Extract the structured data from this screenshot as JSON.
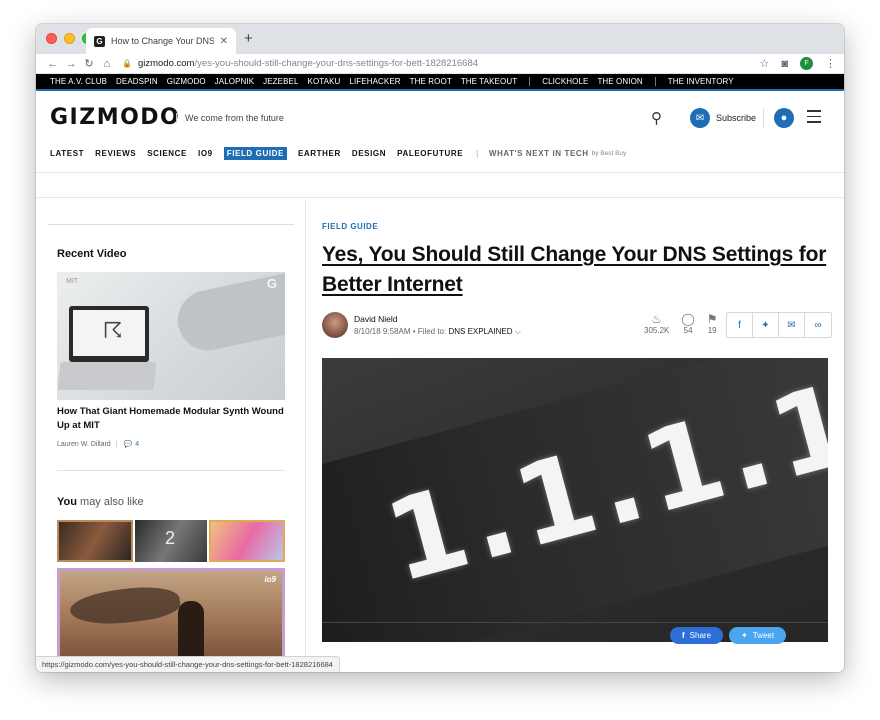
{
  "browser": {
    "tab_title": "How to Change Your DNS Setti",
    "tab_favicon": "G",
    "url_host": "gizmodo.com",
    "url_path": "/yes-you-should-still-change-your-dns-settings-for-bett-1828216684",
    "profile_initial": "F",
    "status_url": "https://gizmodo.com/yes-you-should-still-change-your-dns-settings-for-bett-1828216684"
  },
  "network_bar": {
    "items": [
      "The A.V. Club",
      "Deadspin",
      "Gizmodo",
      "Jalopnik",
      "Jezebel",
      "Kotaku",
      "Lifehacker",
      "The Root",
      "The Takeout"
    ],
    "items2": [
      "ClickHole",
      "The Onion"
    ],
    "items3": [
      "The Inventory"
    ]
  },
  "header": {
    "logo": "GIZMODO",
    "tagline": "We come from the future",
    "subscribe": "Subscribe",
    "categories": [
      "LATEST",
      "REVIEWS",
      "SCIENCE",
      "IO9",
      "FIELD GUIDE",
      "EARTHER",
      "DESIGN",
      "PALEOFUTURE"
    ],
    "active_category": "FIELD GUIDE",
    "whats_next": "WHAT'S NEXT IN TECH",
    "by": "by Best Buy"
  },
  "sidebar": {
    "recent_video_title": "Recent Video",
    "video_source": "MIT",
    "video_badge": "G",
    "video_caption": "How That Giant Homemade Modular Synth Wound Up at MIT",
    "video_author": "Lauren W. Dillard",
    "video_comments": "4",
    "may_like_bold": "You",
    "may_like_rest": " may also like",
    "strip_number": "2",
    "big_badge": "io9"
  },
  "article": {
    "kicker": "FIELD GUIDE",
    "headline": "Yes, You Should Still Change Your DNS Settings for Better Internet",
    "author": "David Nield",
    "date": "8/10/18 9:58AM",
    "filed_to_label": "Filed to:",
    "filed_to": "DNS EXPLAINED",
    "views": "305.2K",
    "comments": "54",
    "saves": "19",
    "hero_text": "1.1.1.1"
  },
  "floating_share": {
    "share": "Share",
    "tweet": "Tweet"
  },
  "colors": {
    "accent": "#1f6db5",
    "facebook": "#2d6fd6",
    "twitter": "#4aa6f0"
  }
}
